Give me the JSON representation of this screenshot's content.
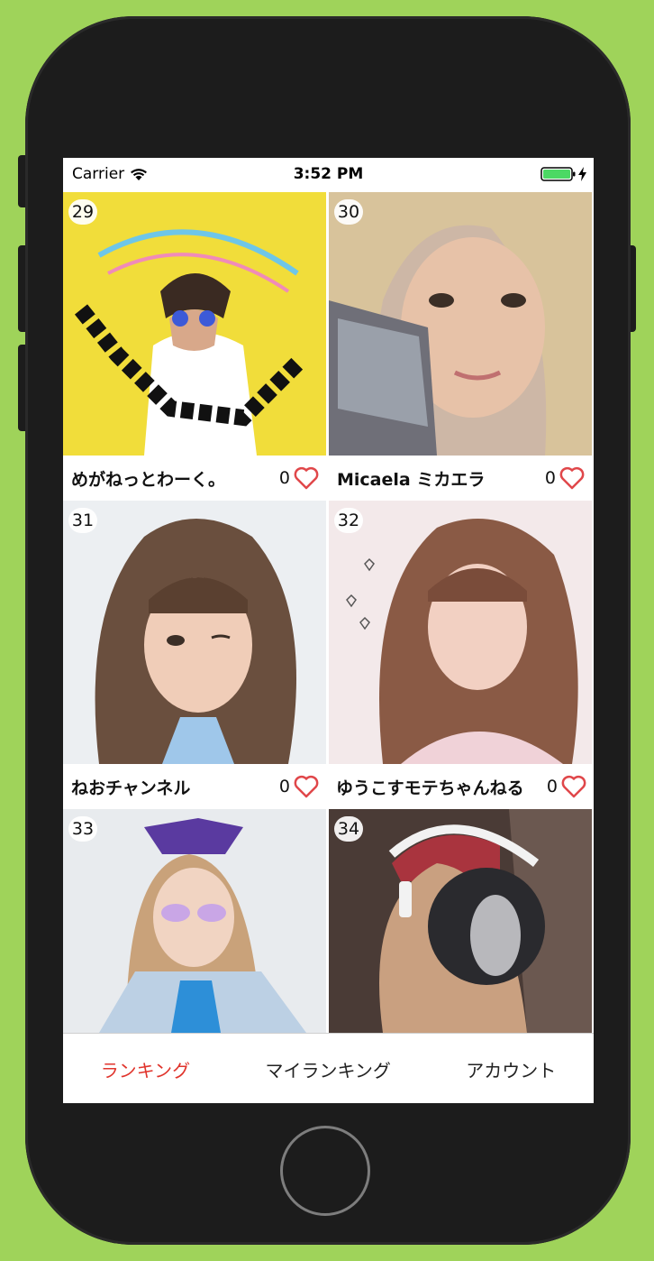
{
  "status_bar": {
    "carrier": "Carrier",
    "time": "3:52 PM"
  },
  "items": [
    {
      "rank": "29",
      "name": "めがねっとわーく。",
      "likes": "0",
      "photo_bg": "#f1dd3a"
    },
    {
      "rank": "30",
      "name": "Micaela ミカエラ",
      "likes": "0",
      "photo_bg": "#d9c0b0"
    },
    {
      "rank": "31",
      "name": "ねおチャンネル",
      "likes": "0",
      "photo_bg": "#e9ecef"
    },
    {
      "rank": "32",
      "name": "ゆうこすモテちゃんねる",
      "likes": "0",
      "photo_bg": "#f1e6e6"
    },
    {
      "rank": "33",
      "name": "",
      "likes": "",
      "photo_bg": "#e6eaee"
    },
    {
      "rank": "34",
      "name": "",
      "likes": "",
      "photo_bg": "#4a3b36"
    }
  ],
  "tabs": [
    {
      "label": "ランキング",
      "active": true
    },
    {
      "label": "マイランキング",
      "active": false
    },
    {
      "label": "アカウント",
      "active": false
    }
  ],
  "colors": {
    "accent": "#e0342c",
    "heart": "#e0474a",
    "battery": "#4cd964"
  }
}
